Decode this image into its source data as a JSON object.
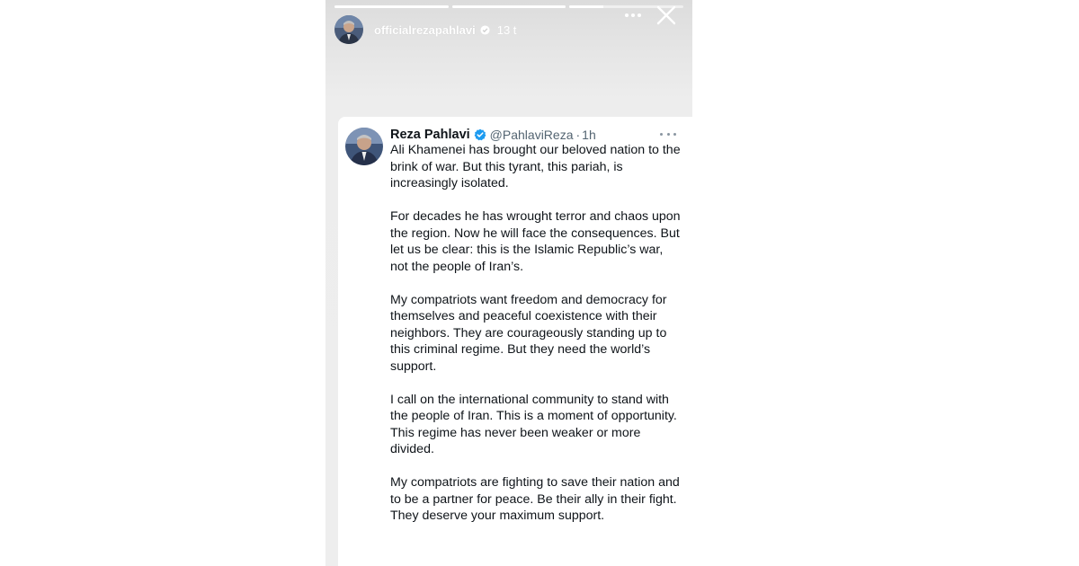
{
  "story": {
    "username": "officialrezapahlavi",
    "time": "13 t",
    "progress": [
      1,
      1,
      0.3
    ],
    "icons": {
      "verified": "verified-badge-icon",
      "more": "more-horizontal-icon",
      "close": "close-icon"
    }
  },
  "tweet": {
    "name": "Reza Pahlavi",
    "handle": "@PahlaviReza",
    "separator": "·",
    "time": "1h",
    "paragraphs": [
      "Ali Khamenei has brought our beloved nation to the brink of war. But this tyrant, this pariah, is increasingly isolated.",
      "For decades he has wrought terror and chaos upon the region. Now he will face the consequences. But let us be clear: this is the Islamic Republic’s war, not the people of Iran’s.",
      "My compatriots want freedom and democracy for themselves and peaceful coexistence with their neighbors. They are courageously standing up to this criminal regime. But they need the world’s support.",
      "I call on the international community to stand with the people of Iran. This is a moment of opportunity. This regime has never been weaker or more divided.",
      "My compatriots are fighting to save their nation and to be a partner for peace. Be their ally in their fight. They deserve your maximum support."
    ],
    "verified_color": "#1d9bf0"
  }
}
